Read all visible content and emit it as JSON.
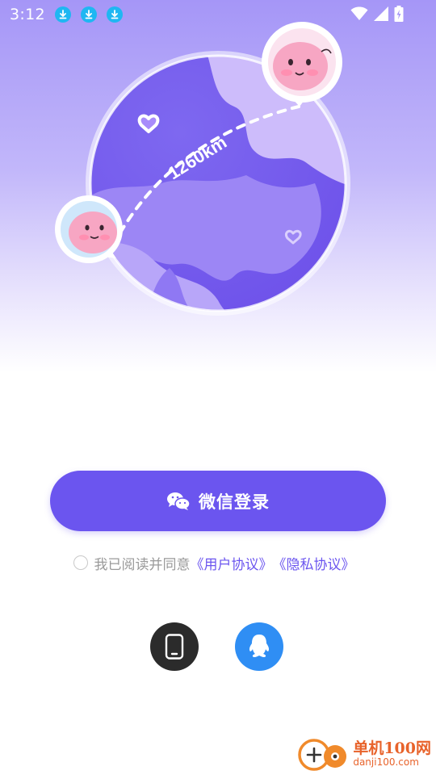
{
  "status_bar": {
    "time": "3:12",
    "notification_icons": [
      "download-icon",
      "download-icon",
      "download-icon"
    ],
    "right_icons": [
      "wifi-icon",
      "cell-signal-icon",
      "battery-icon"
    ]
  },
  "hero": {
    "distance_label": "1260km"
  },
  "login": {
    "wechat_label": "微信登录",
    "wechat_icon": "wechat-icon"
  },
  "agreement": {
    "prefix": "我已阅读并同意",
    "user_agreement": "《用户协议》",
    "privacy_policy": "《隐私协议》"
  },
  "alt_login": {
    "phone_icon": "phone-icon",
    "qq_icon": "qq-icon"
  },
  "watermark": {
    "brand_cn": "单机100网",
    "brand_url": "danji100.com"
  },
  "colors": {
    "primary": "#6b55ef",
    "qq_blue": "#2f8ef4",
    "phone_dark": "#2b2b2b",
    "download_badge": "#1fb7f2"
  }
}
